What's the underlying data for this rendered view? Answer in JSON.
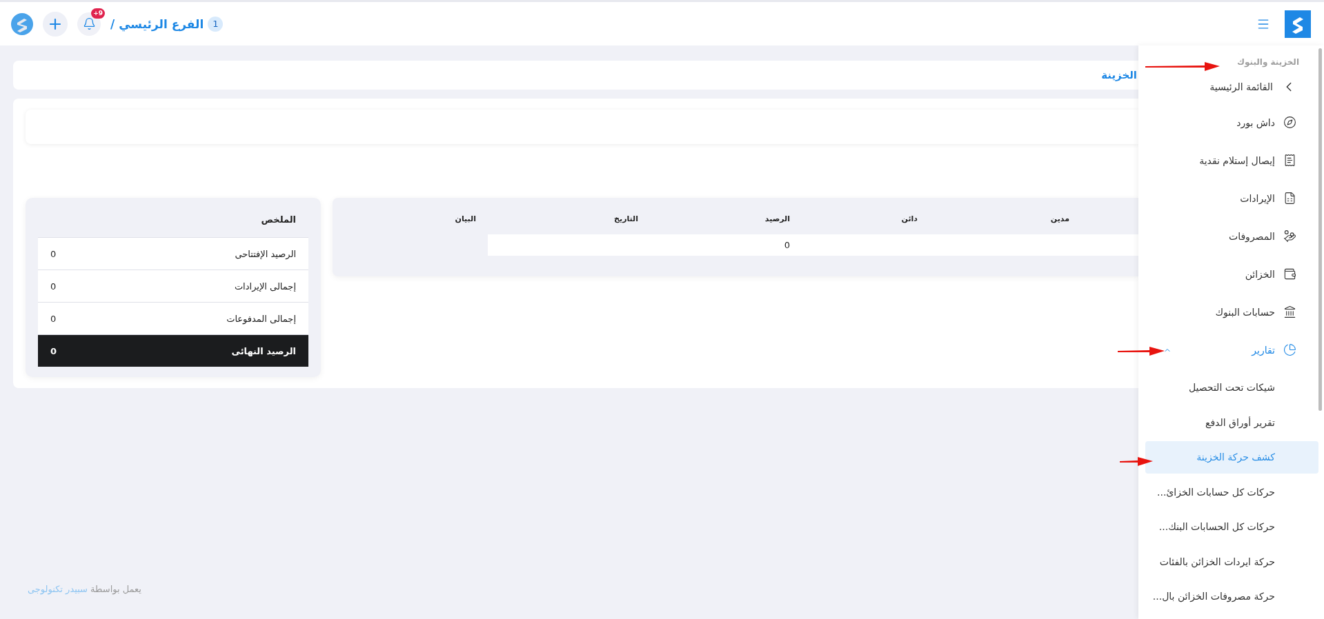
{
  "header": {
    "breadcrumb": {
      "badge": "1",
      "label": "الفرع الرئيسي /"
    },
    "notifications": {
      "badge": "+9"
    }
  },
  "sidebar": {
    "section": "الخزينة والبنوك",
    "back": "القائمة الرئيسية",
    "items": [
      {
        "label": "داش بورد"
      },
      {
        "label": "إيصال إستلام نقدية"
      },
      {
        "label": "الإيرادات"
      },
      {
        "label": "المصروفات"
      },
      {
        "label": "الخزائن"
      },
      {
        "label": "حسابات البنوك"
      },
      {
        "label": "تقارير",
        "expanded": true,
        "children": [
          {
            "label": "شيكات تحت التحصيل",
            "selected": false
          },
          {
            "label": "تقرير أوراق الدفع",
            "selected": false
          },
          {
            "label": "كشف حركة الخزينة",
            "selected": true
          },
          {
            "label": "حركات كل حسابات الخزائ...",
            "selected": false
          },
          {
            "label": "حركات كل الحسابات البنك...",
            "selected": false
          },
          {
            "label": "حركة ايردات الخزائن بالفئات",
            "selected": false
          },
          {
            "label": "حركة مصروفات الخزائن بال...",
            "selected": false
          }
        ]
      }
    ]
  },
  "page": {
    "title": "الخزينة"
  },
  "table": {
    "columns": [
      "مدين",
      "دائن",
      "الرصيد",
      "التاريخ",
      "البيان"
    ],
    "rows": [
      {
        "balance": "0"
      }
    ]
  },
  "summary": {
    "title": "الملخص",
    "rows": [
      {
        "label": "الرصيد الإفتتاحى",
        "value": "0",
        "kind": "line"
      },
      {
        "label": "إجمالى الإيرادات",
        "value": "0",
        "kind": "line"
      },
      {
        "label": "إجمالى المدفوعات",
        "value": "0",
        "kind": "line"
      },
      {
        "label": "الرصيد النهائى",
        "value": "0",
        "kind": "total"
      }
    ]
  },
  "footer": {
    "text": "يعمل بواسطة",
    "link": "سبيدر تكنولوجى"
  }
}
